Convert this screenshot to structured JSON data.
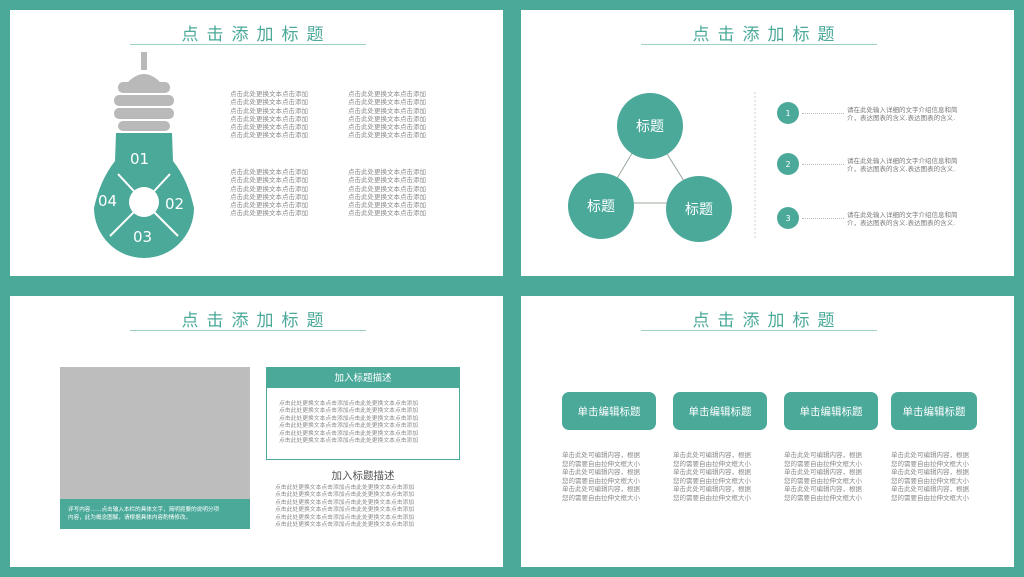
{
  "slide1": {
    "title": "点击添加标题",
    "bulb": {
      "seg1": "01",
      "seg2": "02",
      "seg3": "03",
      "seg4": "04"
    },
    "text_blocks": [
      "点击此处更换文本点击添加\n点击此处更换文本点击添加\n点击此处更换文本点击添加\n点击此处更换文本点击添加\n点击此处更换文本点击添加\n点击此处更换文本点击添加",
      "点击此处更换文本点击添加\n点击此处更换文本点击添加\n点击此处更换文本点击添加\n点击此处更换文本点击添加\n点击此处更换文本点击添加\n点击此处更换文本点击添加",
      "点击此处更换文本点击添加\n点击此处更换文本点击添加\n点击此处更换文本点击添加\n点击此处更换文本点击添加\n点击此处更换文本点击添加\n点击此处更换文本点击添加",
      "点击此处更换文本点击添加\n点击此处更换文本点击添加\n点击此处更换文本点击添加\n点击此处更换文本点击添加\n点击此处更换文本点击添加\n点击此处更换文本点击添加"
    ]
  },
  "slide2": {
    "title": "点击添加标题",
    "circles": [
      "标题",
      "标题",
      "标题"
    ],
    "items": [
      {
        "num": "1",
        "text": "请在此处输入详细的文字介绍信息和简\n介，表达图表的含义.表达图表的含义."
      },
      {
        "num": "2",
        "text": "请在此处输入详细的文字介绍信息和简\n介，表达图表的含义.表达图表的含义."
      },
      {
        "num": "3",
        "text": "请在此处输入详细的文字介绍信息和简\n介，表达图表的含义.表达图表的含义."
      }
    ]
  },
  "slide3": {
    "title": "点击添加标题",
    "caption": "评写内容……点击输入本栏的具体文字，简明扼要的说明分项\n内容，此为概念图解，请根据具体内容酌情修改。",
    "box_title": "加入标题描述",
    "box_text": "点击此处更换文本点击添加点击此处更换文本点击添加\n点击此处更换文本点击添加点击此处更换文本点击添加\n点击此处更换文本点击添加点击此处更换文本点击添加\n点击此处更换文本点击添加点击此处更换文本点击添加\n点击此处更换文本点击添加点击此处更换文本点击添加\n点击此处更换文本点击添加点击此处更换文本点击添加",
    "sub_title": "加入标题描述",
    "sub_text": "点击此处更换文本点击添加点击此处更换文本点击添加\n点击此处更换文本点击添加点击此处更换文本点击添加\n点击此处更换文本点击添加点击此处更换文本点击添加\n点击此处更换文本点击添加点击此处更换文本点击添加\n点击此处更换文本点击添加点击此处更换文本点击添加\n点击此处更换文本点击添加点击此处更换文本点击添加"
  },
  "slide4": {
    "title": "点击添加标题",
    "columns": [
      {
        "button": "单击编辑标题",
        "text": "单击此处可编辑内容，根据\n您的需要自由拉伸文框大小\n单击此处可编辑内容，根据\n您的需要自由拉伸文框大小\n单击此处可编辑内容，根据\n您的需要自由拉伸文框大小"
      },
      {
        "button": "单击编辑标题",
        "text": "单击此处可编辑内容，根据\n您的需要自由拉伸文框大小\n单击此处可编辑内容，根据\n您的需要自由拉伸文框大小\n单击此处可编辑内容，根据\n您的需要自由拉伸文框大小"
      },
      {
        "button": "单击编辑标题",
        "text": "单击此处可编辑内容，根据\n您的需要自由拉伸文框大小\n单击此处可编辑内容，根据\n您的需要自由拉伸文框大小\n单击此处可编辑内容，根据\n您的需要自由拉伸文框大小"
      },
      {
        "button": "单击编辑标题",
        "text": "单击此处可编辑内容，根据\n您的需要自由拉伸文框大小\n单击此处可编辑内容，根据\n您的需要自由拉伸文框大小\n单击此处可编辑内容，根据\n您的需要自由拉伸文框大小"
      }
    ]
  },
  "colors": {
    "accent": "#4ba99a",
    "gray": "#b9b9b9",
    "text": "#8a8a8a"
  }
}
